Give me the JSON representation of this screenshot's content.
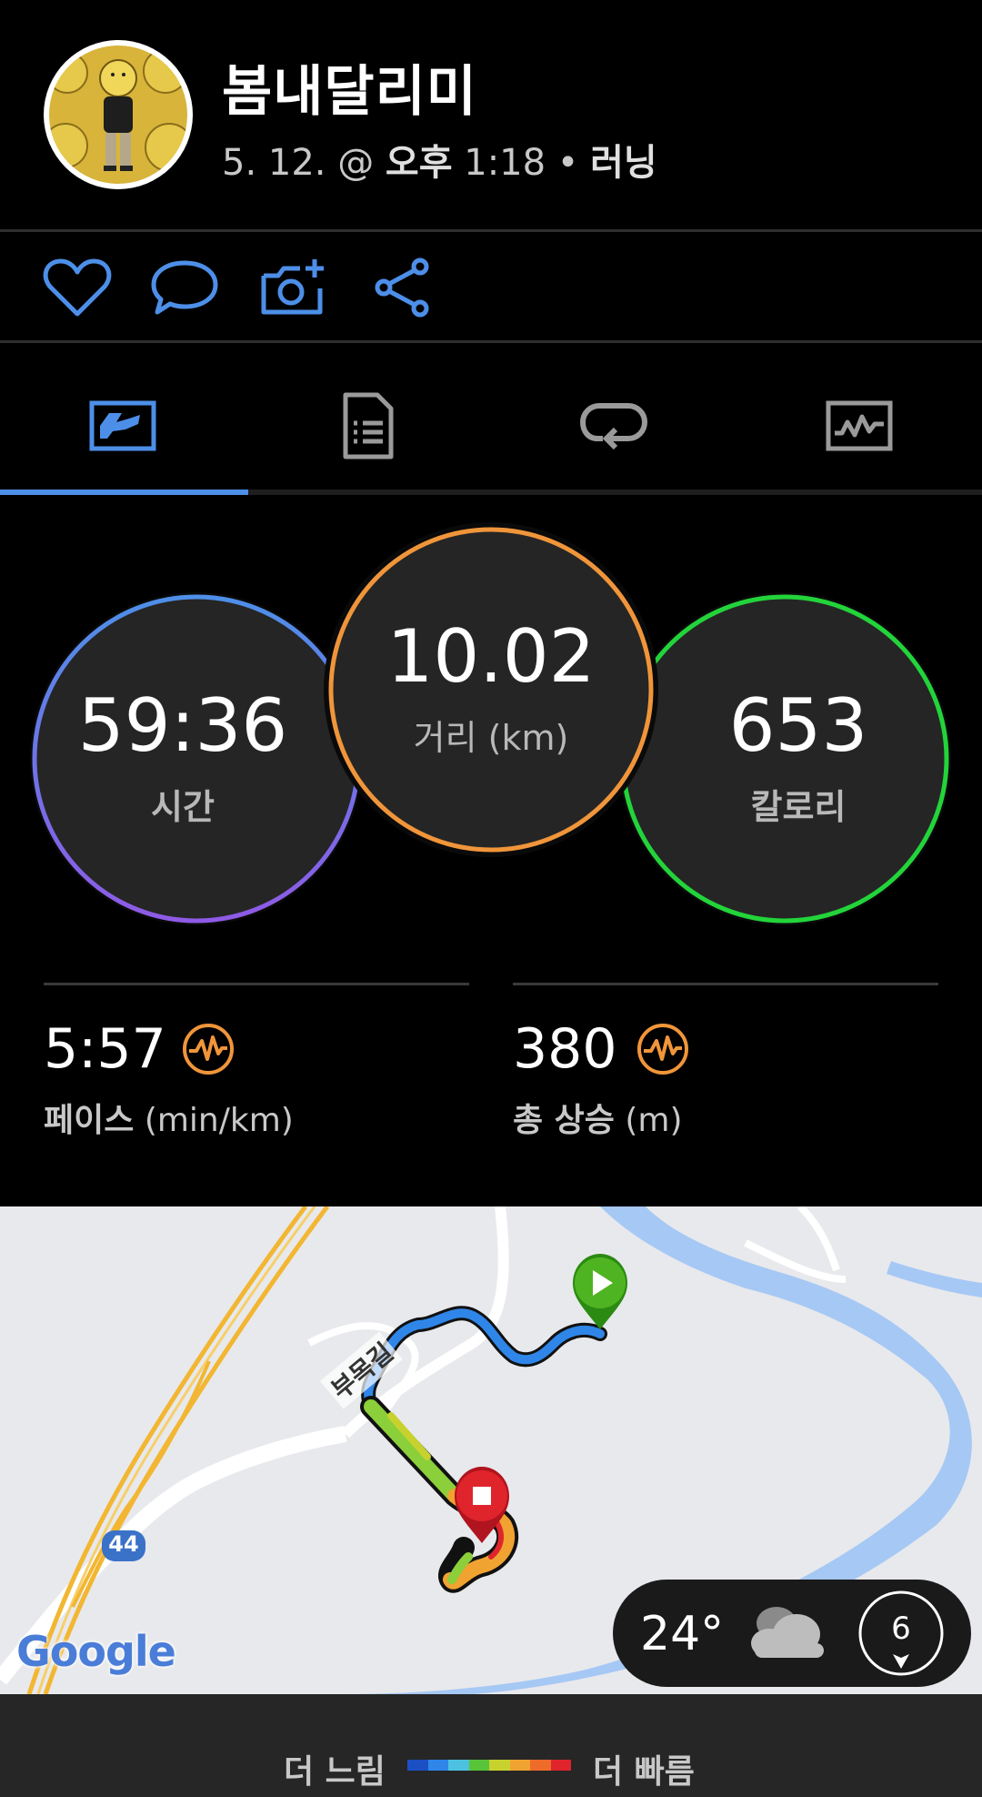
{
  "header": {
    "user_name": "봄내달리미",
    "date": "5. 12. @ ",
    "time_prefix": "오후",
    "time": " 1:18 • ",
    "activity": "러닝"
  },
  "actions": [
    "heart-icon",
    "comment-icon",
    "add-photo-icon",
    "share-icon"
  ],
  "tabs": [
    {
      "icon": "summary-chart-icon",
      "selected": true
    },
    {
      "icon": "details-document-icon",
      "selected": false
    },
    {
      "icon": "laps-loop-icon",
      "selected": false
    },
    {
      "icon": "graphs-icon",
      "selected": false
    }
  ],
  "summary": {
    "time": {
      "value": "59:36",
      "label": "시간"
    },
    "distance": {
      "value": "10.02",
      "label": "거리 (km)"
    },
    "calories": {
      "value": "653",
      "label": "칼로리"
    }
  },
  "stats": {
    "pace": {
      "value": "5:57",
      "label_bold": "페이스",
      "label_unit": " (min/km)"
    },
    "ascent": {
      "value": "380",
      "label_bold": "총 상승",
      "label_unit": " (m)"
    }
  },
  "map": {
    "road_label": "부목길",
    "route_sign": "44",
    "brand": "Google"
  },
  "weather": {
    "temperature": "24°",
    "wind_speed": "6"
  },
  "legend": {
    "slow": "더 느림",
    "fast": "더 빠름",
    "colors": [
      "#1b4fc4",
      "#2f86e8",
      "#4cc2e0",
      "#58c43a",
      "#c8d22f",
      "#f0a330",
      "#ee6b2a",
      "#e0242c"
    ]
  },
  "colors": {
    "accent": "#4d8fe8",
    "time_ring": [
      "#4d8fe8",
      "#8e5ae6"
    ],
    "distance_ring": "#f0953a",
    "calories_ring": "#22d43a",
    "stat_icon": "#f0953a"
  }
}
